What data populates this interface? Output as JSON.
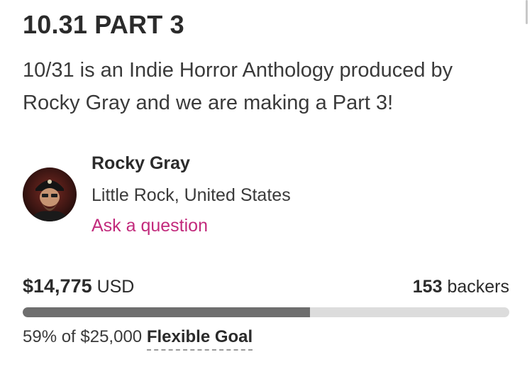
{
  "project": {
    "title": "10.31 PART 3",
    "blurb": "10/31 is an Indie Horror Anthology produced by Rocky Gray and we are making a Part 3!"
  },
  "creator": {
    "name": "Rocky Gray",
    "location": "Little Rock, United States",
    "ask_label": "Ask a question"
  },
  "funding": {
    "pledged": "$14,775",
    "currency": "USD",
    "backers_count": "153",
    "backers_label": "backers",
    "percent_text": "59% of $25,000",
    "progress_fraction": 0.591,
    "goal_type": "Flexible Goal"
  },
  "colors": {
    "link": "#c22a7c",
    "progress_fill": "#6e6e6e",
    "progress_track": "#dcdcdc"
  }
}
